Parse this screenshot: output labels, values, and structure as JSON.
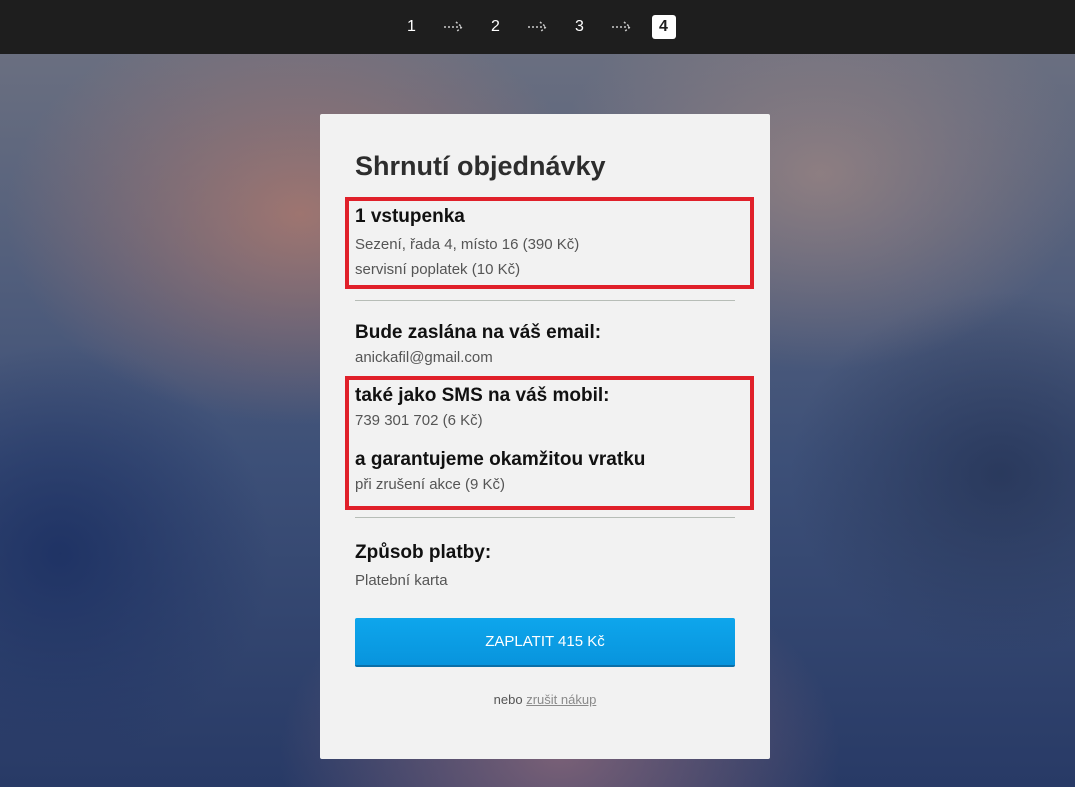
{
  "steps": {
    "items": [
      "1",
      "2",
      "3",
      "4"
    ],
    "active_index": 4
  },
  "summary": {
    "title": "Shrnutí objednávky",
    "ticket": {
      "heading": "1 vstupenka",
      "seat": "Sezení, řada 4, místo 16 (390 Kč)",
      "fee": "servisní poplatek (10 Kč)"
    },
    "email": {
      "heading": "Bude zaslána na váš email:",
      "value": "anickafil@gmail.com"
    },
    "sms": {
      "heading": "také jako SMS na váš mobil:",
      "value": "739 301 702 (6 Kč)"
    },
    "refund": {
      "heading": "a garantujeme okamžitou vratku",
      "value": "při zrušení akce (9 Kč)"
    },
    "payment": {
      "heading": "Způsob platby:",
      "value": "Platební karta"
    },
    "pay_button": "ZAPLATIT 415 Kč",
    "footer": {
      "prefix": "nebo",
      "cancel_link": "zrušit nákup"
    }
  },
  "colors": {
    "highlight": "#e0202a",
    "button": "#0ea6ec",
    "topbar": "#1e1e1e"
  }
}
